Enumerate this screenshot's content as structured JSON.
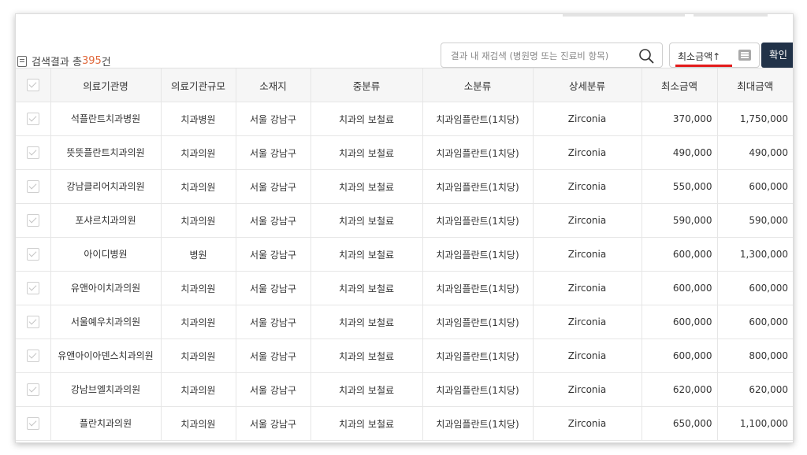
{
  "toolbar": {
    "result_prefix": "검색결과 총",
    "result_count": "395",
    "result_suffix": "건",
    "search_placeholder": "결과 내 재검색 (병원명 또는 진료비 항목)",
    "sort_label": "최소금액↑",
    "confirm_label": "확인",
    "sort_underline_color": "#e31b1b"
  },
  "table": {
    "headers": [
      "의료기관명",
      "의료기관규모",
      "소재지",
      "중분류",
      "소분류",
      "상세분류",
      "최소금액",
      "최대금액"
    ],
    "rows": [
      {
        "name": "석플란트치과병원",
        "size": "치과병원",
        "loc": "서울 강남구",
        "mid": "치과의 보철료",
        "sub": "치과임플란트(1치당)",
        "detail": "Zirconia",
        "min": "370,000",
        "max": "1,750,000"
      },
      {
        "name": "뜻뜻플란트치과의원",
        "size": "치과의원",
        "loc": "서울 강남구",
        "mid": "치과의 보철료",
        "sub": "치과임플란트(1치당)",
        "detail": "Zirconia",
        "min": "490,000",
        "max": "490,000"
      },
      {
        "name": "강남클리어치과의원",
        "size": "치과의원",
        "loc": "서울 강남구",
        "mid": "치과의 보철료",
        "sub": "치과임플란트(1치당)",
        "detail": "Zirconia",
        "min": "550,000",
        "max": "600,000"
      },
      {
        "name": "포샤르치과의원",
        "size": "치과의원",
        "loc": "서울 강남구",
        "mid": "치과의 보철료",
        "sub": "치과임플란트(1치당)",
        "detail": "Zirconia",
        "min": "590,000",
        "max": "590,000"
      },
      {
        "name": "아이디병원",
        "size": "병원",
        "loc": "서울 강남구",
        "mid": "치과의 보철료",
        "sub": "치과임플란트(1치당)",
        "detail": "Zirconia",
        "min": "600,000",
        "max": "1,300,000"
      },
      {
        "name": "유앤아이치과의원",
        "size": "치과의원",
        "loc": "서울 강남구",
        "mid": "치과의 보철료",
        "sub": "치과임플란트(1치당)",
        "detail": "Zirconia",
        "min": "600,000",
        "max": "600,000"
      },
      {
        "name": "서울예우치과의원",
        "size": "치과의원",
        "loc": "서울 강남구",
        "mid": "치과의 보철료",
        "sub": "치과임플란트(1치당)",
        "detail": "Zirconia",
        "min": "600,000",
        "max": "600,000"
      },
      {
        "name": "유앤아이아덴스치과의원",
        "size": "치과의원",
        "loc": "서울 강남구",
        "mid": "치과의 보철료",
        "sub": "치과임플란트(1치당)",
        "detail": "Zirconia",
        "min": "600,000",
        "max": "800,000"
      },
      {
        "name": "강남브엘치과의원",
        "size": "치과의원",
        "loc": "서울 강남구",
        "mid": "치과의 보철료",
        "sub": "치과임플란트(1치당)",
        "detail": "Zirconia",
        "min": "620,000",
        "max": "620,000"
      },
      {
        "name": "플란치과의원",
        "size": "치과의원",
        "loc": "서울 강남구",
        "mid": "치과의 보철료",
        "sub": "치과임플란트(1치당)",
        "detail": "Zirconia",
        "min": "650,000",
        "max": "1,100,000"
      }
    ]
  }
}
